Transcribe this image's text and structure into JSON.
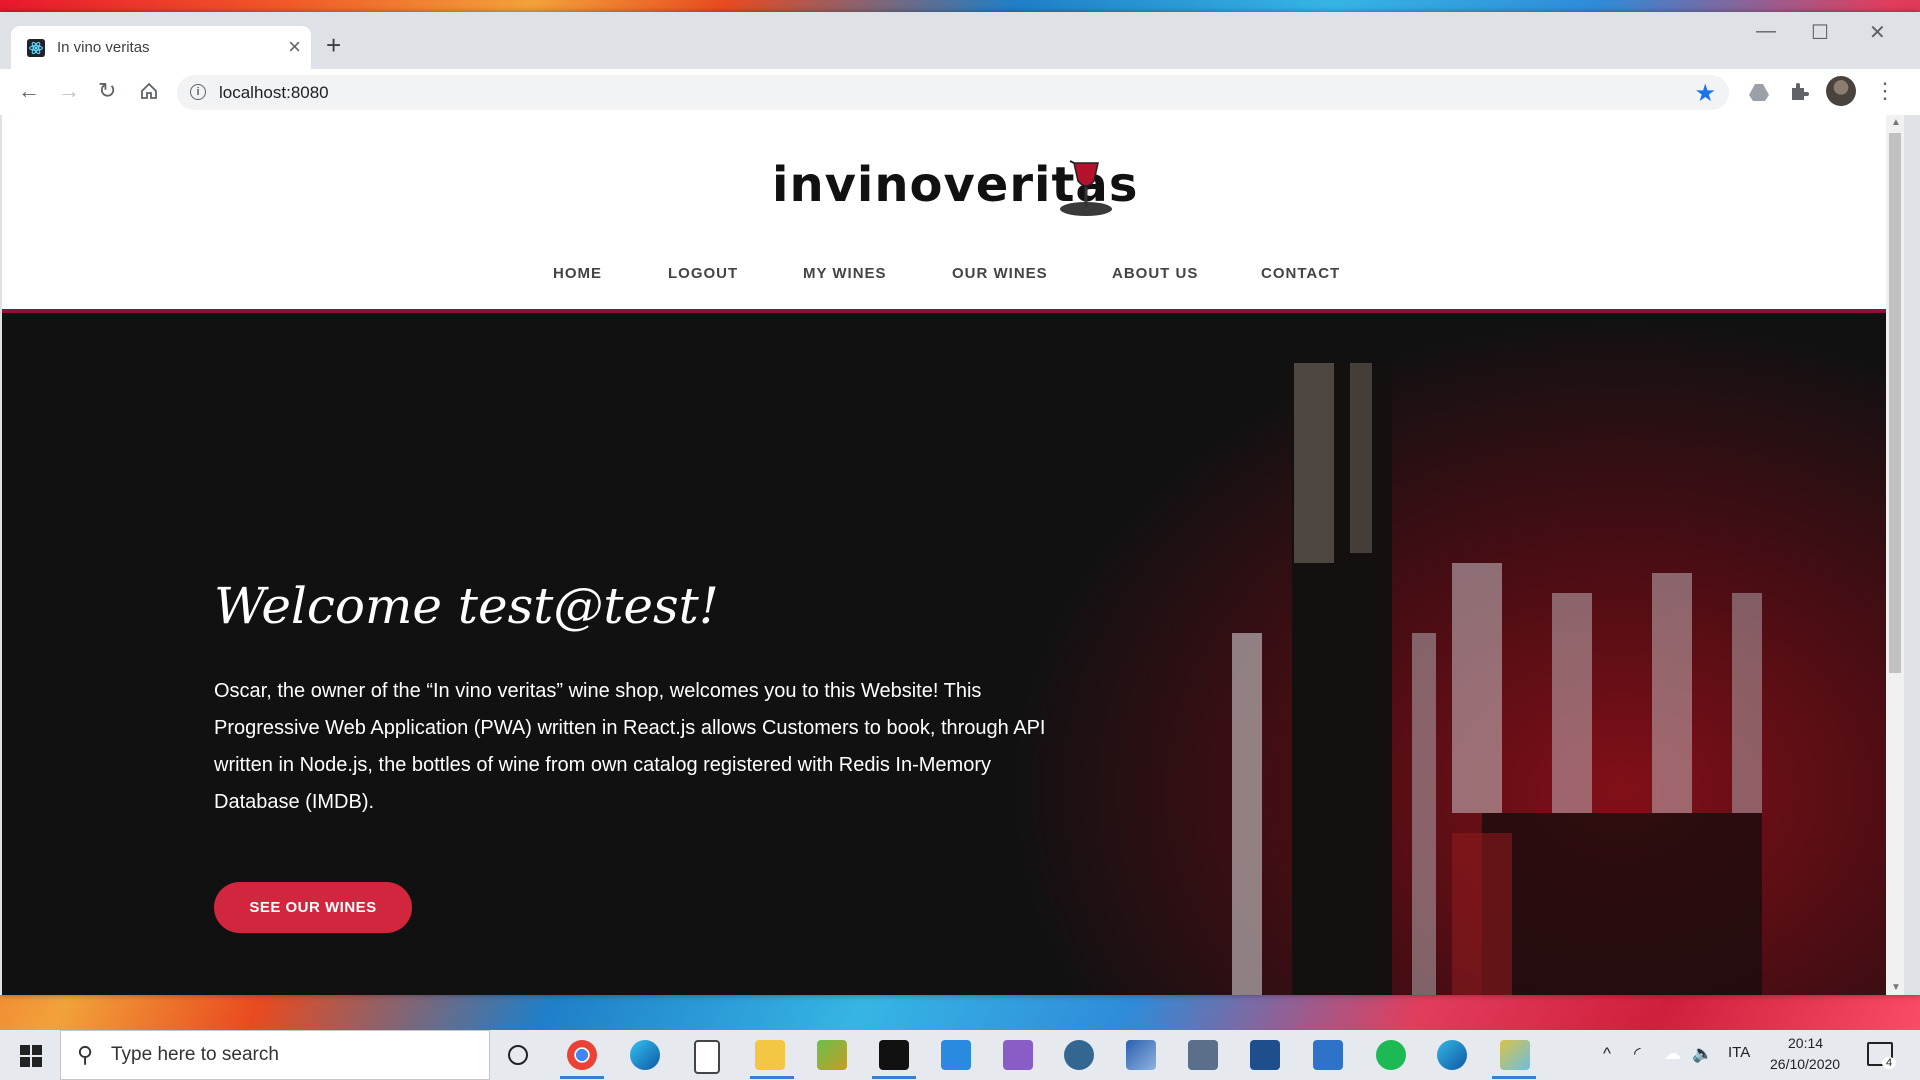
{
  "browser": {
    "tab_title": "In vino veritas",
    "tab_close": "×",
    "new_tab": "+",
    "url": "localhost:8080",
    "minimize": "—",
    "maximize": "☐",
    "close": "✕"
  },
  "site": {
    "logo_text": "invinoveritas",
    "nav": [
      "HOME",
      "LOGOUT",
      "MY WINES",
      "OUR WINES",
      "ABOUT US",
      "CONTACT"
    ]
  },
  "hero": {
    "heading": "Welcome test@test!",
    "body": "Oscar, the owner of the “In vino veritas” wine shop, welcomes you to this Website! This Progressive Web Application (PWA) written in React.js allows Customers to book, through API written in Node.js, the bottles of wine from own catalog registered with Redis In-Memory Database (IMDB).",
    "cta": "SEE OUR WINES"
  },
  "taskbar": {
    "search_placeholder": "Type here to search",
    "language": "ITA",
    "time": "20:14",
    "date": "26/10/2020",
    "notification_count": "4"
  },
  "colors": {
    "accent": "#d2263f",
    "nav_border": "#8e0f3b",
    "hero_bg": "#111112"
  }
}
